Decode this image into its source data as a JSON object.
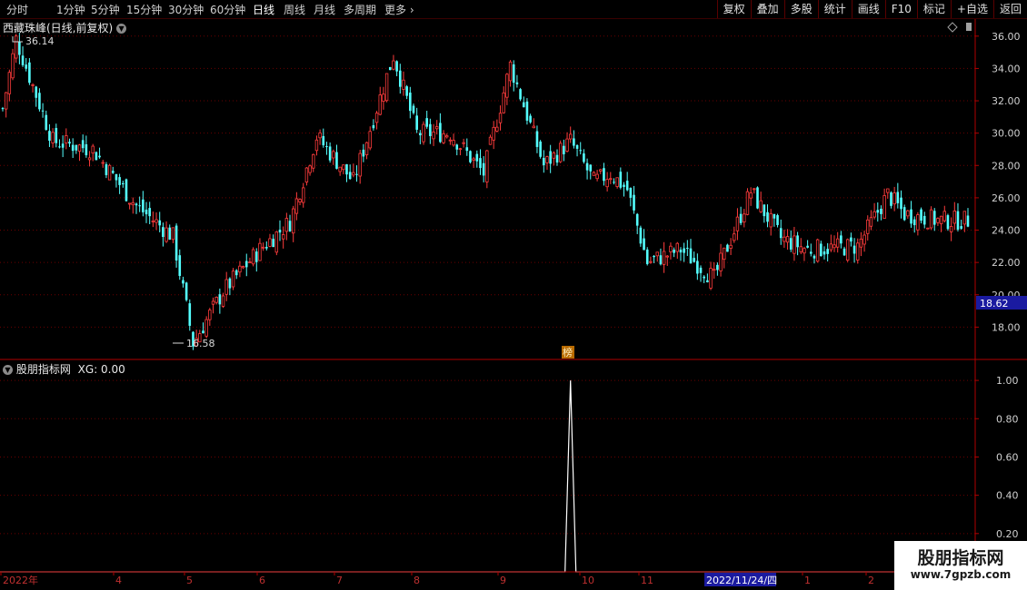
{
  "toolbar": {
    "periods": [
      "分时",
      "1分钟",
      "5分钟",
      "15分钟",
      "30分钟",
      "60分钟",
      "日线",
      "周线",
      "月线",
      "多周期",
      "更多"
    ],
    "active_period": "日线",
    "right_tools": [
      "复权",
      "叠加",
      "多股",
      "统计",
      "画线",
      "F10",
      "标记",
      "+自选",
      "返回"
    ]
  },
  "main_panel": {
    "title": "西藏珠峰(日线,前复权)",
    "high_label": "36.14",
    "low_label": "16.58",
    "current_price": "18.62",
    "badge": "榜"
  },
  "indicator_panel": {
    "title": "股朋指标网",
    "value_label": "XG: 0.00"
  },
  "axis": {
    "price_ticks": [
      "36.00",
      "34.00",
      "32.00",
      "30.00",
      "28.00",
      "26.00",
      "24.00",
      "22.00",
      "20.00",
      "18.00"
    ],
    "indicator_ticks": [
      "1.00",
      "0.80",
      "0.60",
      "0.40",
      "0.20"
    ],
    "dates": [
      "2022年",
      "4",
      "5",
      "6",
      "7",
      "8",
      "9",
      "10",
      "11",
      "1",
      "2"
    ],
    "cursor_date": "2022/11/24/四"
  },
  "watermark": {
    "title": "股朋指标网",
    "url": "www.7gpzb.com"
  },
  "colors": {
    "up": "#ff3c3c",
    "down": "#54ffff",
    "grid": "#6a0000",
    "axis_line": "#b00000",
    "indicator_line": "#ffffff"
  },
  "chart_data": [
    {
      "type": "candlestick",
      "title": "西藏珠峰(日线,前复权)",
      "ylim": [
        16,
        37
      ],
      "anchors_index": [
        0,
        4,
        15,
        27,
        40,
        51,
        57,
        66,
        77,
        86,
        94,
        105,
        117,
        124,
        134,
        144,
        152,
        162,
        170,
        177,
        182,
        187,
        193,
        203,
        213,
        224,
        233,
        241,
        256,
        265,
        270,
        280
      ],
      "anchors_close": [
        31.5,
        35.8,
        29.5,
        29.0,
        25.5,
        23.6,
        17.0,
        20.2,
        22.8,
        24.5,
        29.8,
        27.0,
        34.8,
        30.0,
        30.0,
        27.5,
        34.2,
        28.0,
        29.5,
        27.0,
        27.5,
        26.5,
        22.0,
        22.8,
        21.0,
        26.4,
        23.5,
        22.8,
        23.0,
        26.2,
        25.0,
        24.6
      ],
      "candle_count": 290,
      "high": 36.14,
      "low": 16.58,
      "last": 18.62
    },
    {
      "type": "line",
      "title": "股朋指标网",
      "series": [
        {
          "name": "XG",
          "spike_index": 170,
          "spike_value": 1.0
        }
      ],
      "baseline": 0.0,
      "ylim": [
        0,
        1.1
      ]
    }
  ]
}
